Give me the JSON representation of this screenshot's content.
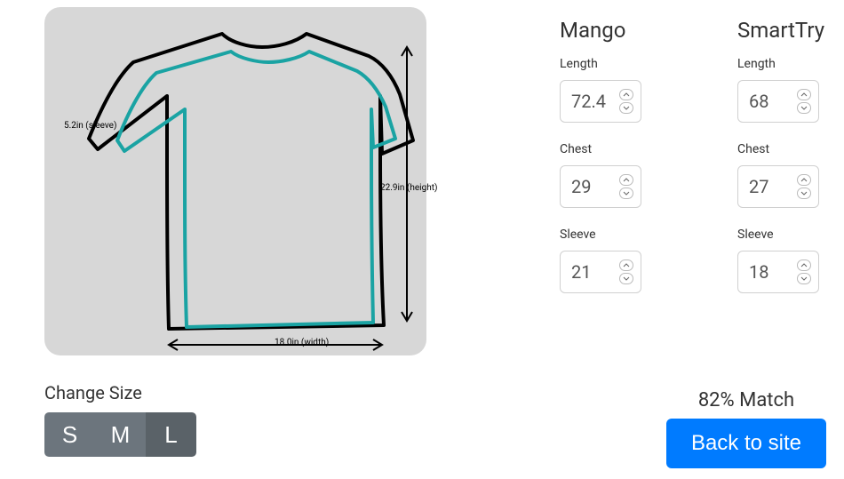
{
  "diagram": {
    "sleeve_label": "5.2in (sleeve)",
    "height_label": "22.9in (height)",
    "width_label": "18.0in (width)"
  },
  "change_size": {
    "title": "Change Size",
    "sizes": {
      "s": "S",
      "m": "M",
      "l": "L"
    },
    "active": "L"
  },
  "brands": {
    "mango": {
      "name": "Mango",
      "length_label": "Length",
      "length_value": "72.4",
      "chest_label": "Chest",
      "chest_value": "29",
      "sleeve_label": "Sleeve",
      "sleeve_value": "21"
    },
    "smarttry": {
      "name": "SmartTry",
      "length_label": "Length",
      "length_value": "68",
      "chest_label": "Chest",
      "chest_value": "27",
      "sleeve_label": "Sleeve",
      "sleeve_value": "18"
    }
  },
  "match_text": "82% Match",
  "back_button": "Back to site"
}
